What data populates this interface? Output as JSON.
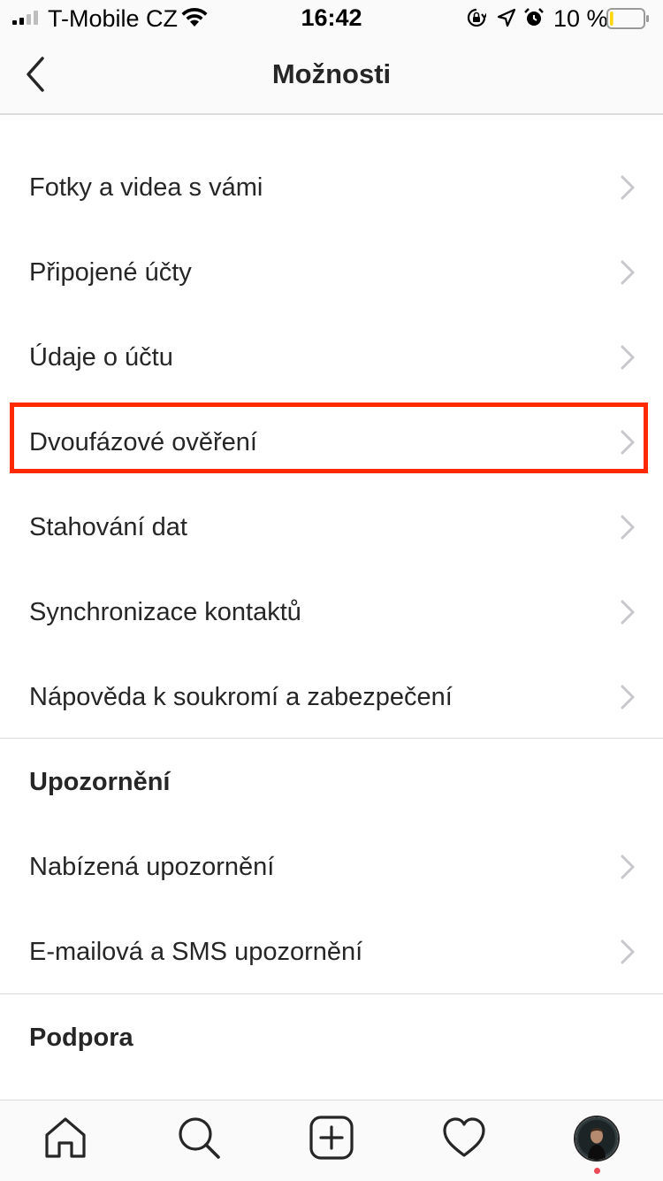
{
  "status_bar": {
    "carrier": "T-Mobile CZ",
    "time": "16:42",
    "battery_percent": "10 %",
    "battery_level": 0.1,
    "battery_color": "#ffd60a"
  },
  "header": {
    "title": "Možnosti",
    "back_icon": "chevron-left-icon"
  },
  "settings": {
    "items": [
      {
        "label": "Fotky a videa s vámi"
      },
      {
        "label": "Připojené účty"
      },
      {
        "label": "Údaje o účtu"
      },
      {
        "label": "Dvoufázové ověření",
        "highlighted": true
      },
      {
        "label": "Stahování dat"
      },
      {
        "label": "Synchronizace kontaktů"
      },
      {
        "label": "Nápověda k soukromí a zabezpečení"
      }
    ]
  },
  "notifications": {
    "heading": "Upozornění",
    "items": [
      {
        "label": "Nabízená upozornění"
      },
      {
        "label": "E-mailová a SMS upozornění"
      }
    ]
  },
  "support": {
    "heading": "Podpora"
  },
  "tab_bar": {
    "tabs": [
      "home-icon",
      "search-icon",
      "add-post-icon",
      "heart-icon",
      "profile-avatar"
    ],
    "notification_dot_color": "#ed4956"
  },
  "colors": {
    "text": "#262626",
    "divider": "#dbdbdb",
    "chevron": "#c7c7cc",
    "highlight_border": "#ff2a00"
  }
}
